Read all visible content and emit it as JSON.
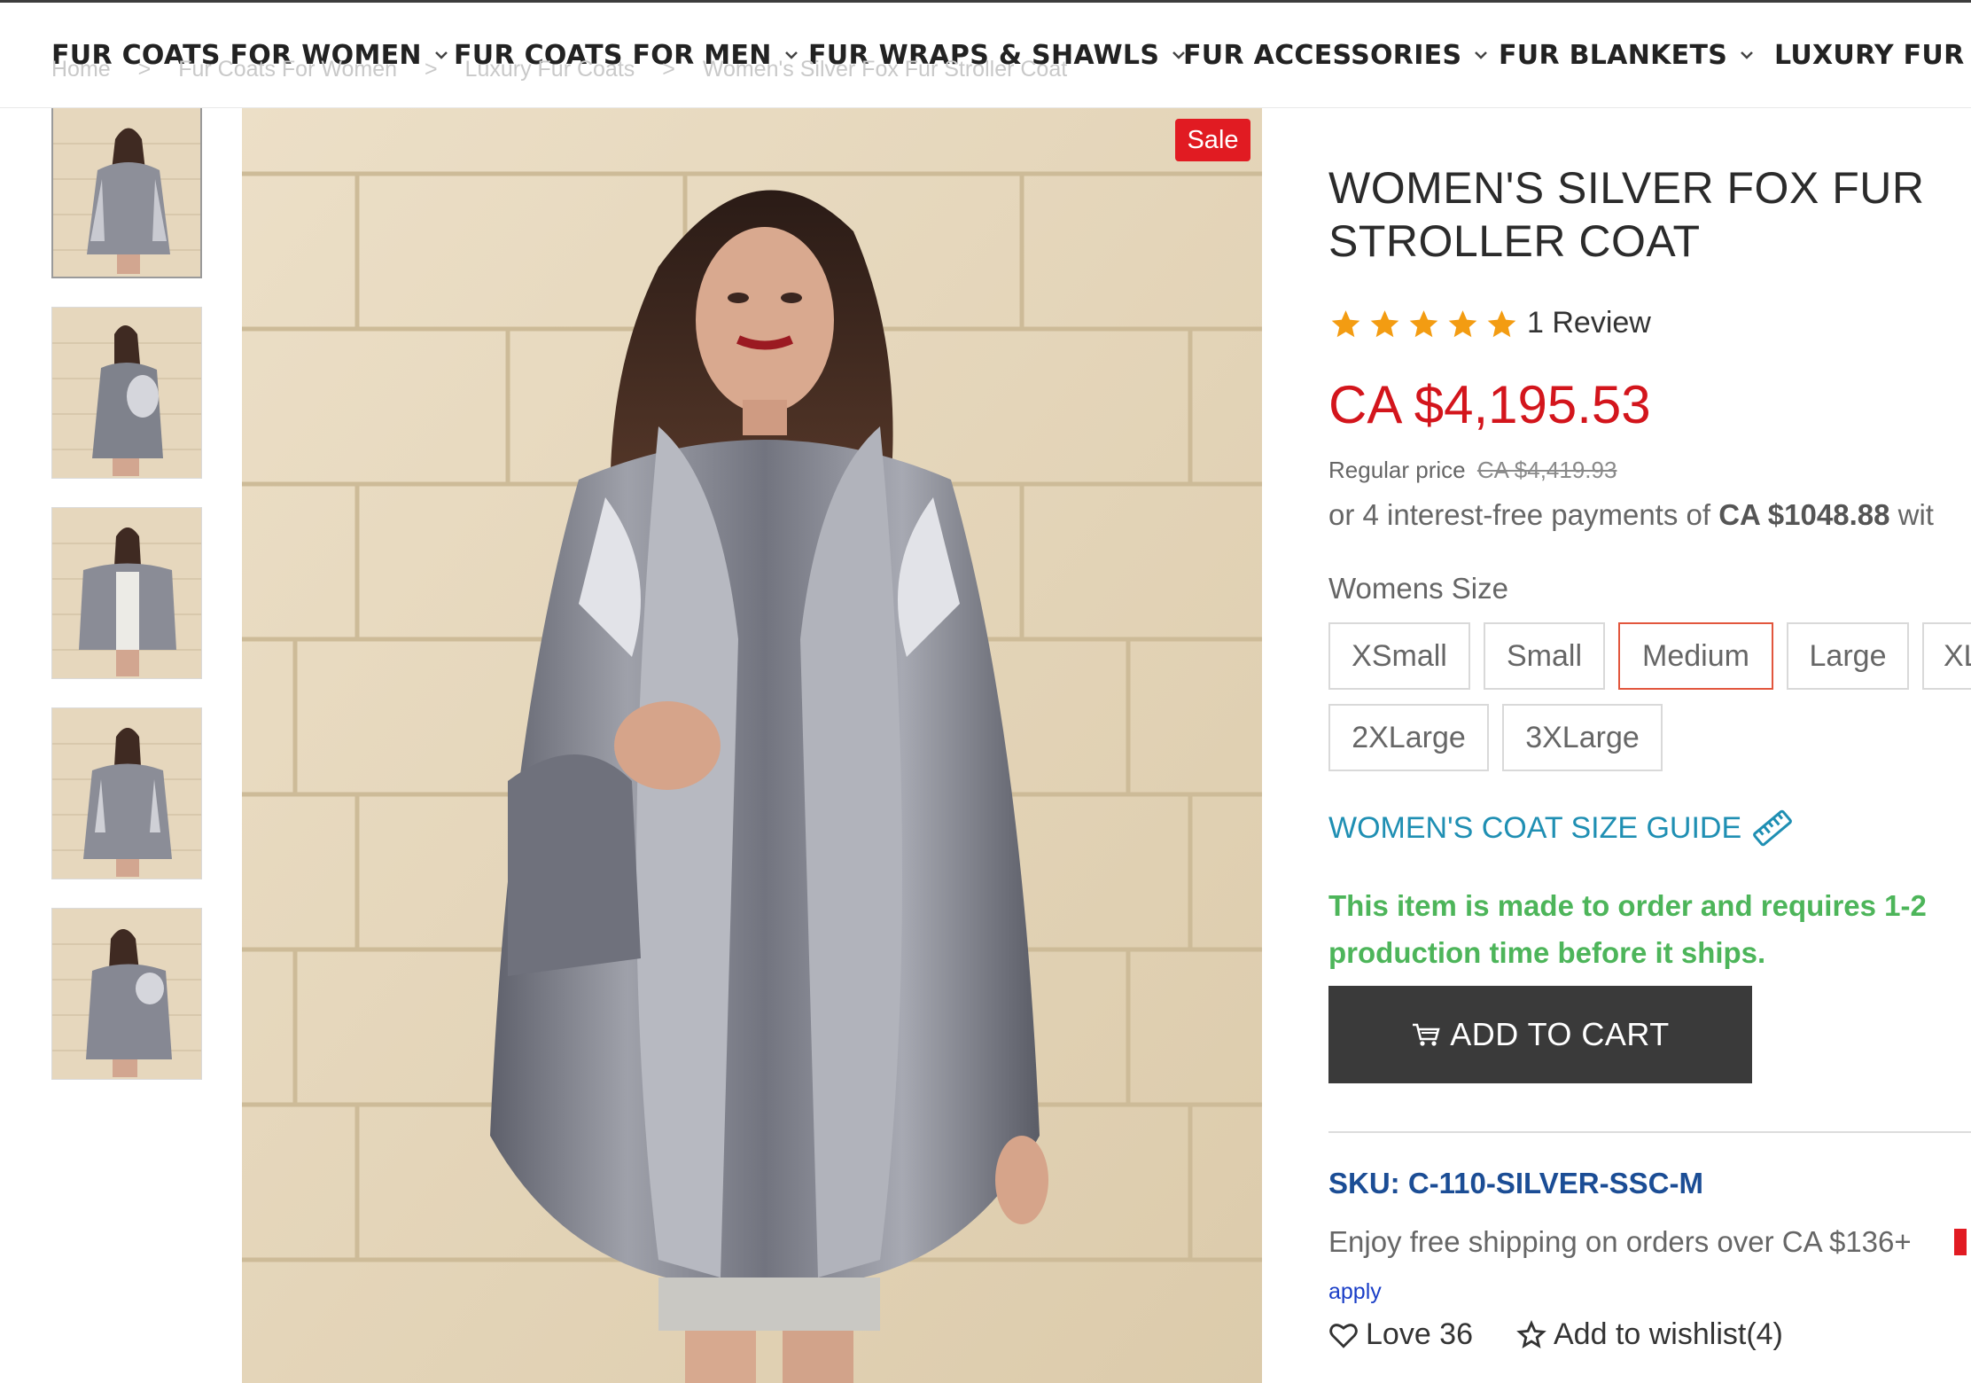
{
  "nav": {
    "items": [
      {
        "label": "FUR COATS FOR WOMEN",
        "has_dropdown": true
      },
      {
        "label": "FUR COATS FOR MEN",
        "has_dropdown": true
      },
      {
        "label": "FUR WRAPS & SHAWLS",
        "has_dropdown": true
      },
      {
        "label": "FUR ACCESSORIES",
        "has_dropdown": true
      },
      {
        "label": "FUR BLANKETS",
        "has_dropdown": true
      },
      {
        "label": "LUXURY FUR",
        "has_dropdown": false
      }
    ]
  },
  "breadcrumb": {
    "items": [
      "Home",
      ">",
      "Fur Coats For Women",
      ">",
      "Luxury Fur Coats",
      ">",
      "Women's Silver Fox Fur Stroller Coat"
    ]
  },
  "gallery": {
    "sale_badge": "Sale",
    "thumbnail_count": 5,
    "active_thumbnail": 1
  },
  "product": {
    "title": "WOMEN'S SILVER FOX FUR STROLLER COAT",
    "rating": 5,
    "review_label": "1 Review",
    "price": "CA $4,195.53",
    "regular_price_label": "Regular price",
    "regular_price": "CA $4,419.93",
    "payments_prefix": "or 4 interest-free payments of",
    "payments_amount": "CA $1048.88",
    "payments_suffix": "wit",
    "size_label": "Womens Size",
    "sizes": [
      "XSmall",
      "Small",
      "Medium",
      "Large",
      "XL",
      "2XLarge",
      "3XLarge"
    ],
    "selected_size": "Medium",
    "size_guide": "WOMEN'S COAT SIZE GUIDE",
    "made_to_order_line1": "This item is made to order and requires 1-2",
    "made_to_order_line2": "production time before it ships.",
    "add_to_cart": "ADD TO CART",
    "sku": "SKU: C-110-SILVER-SSC-M",
    "shipping": "Enjoy free shipping on orders over CA $136+",
    "apply": "apply",
    "love": "Love 36",
    "wishlist": "Add to wishlist(4)"
  },
  "colors": {
    "price_red": "#d3151c",
    "sale_red": "#e11b22",
    "selected_border": "#e2563d",
    "link_blue": "#1f8fb3",
    "note_green": "#4db55a",
    "sku_blue": "#1b4d95",
    "star_orange": "#f39c12",
    "cart_bg": "#3a3a3a"
  }
}
